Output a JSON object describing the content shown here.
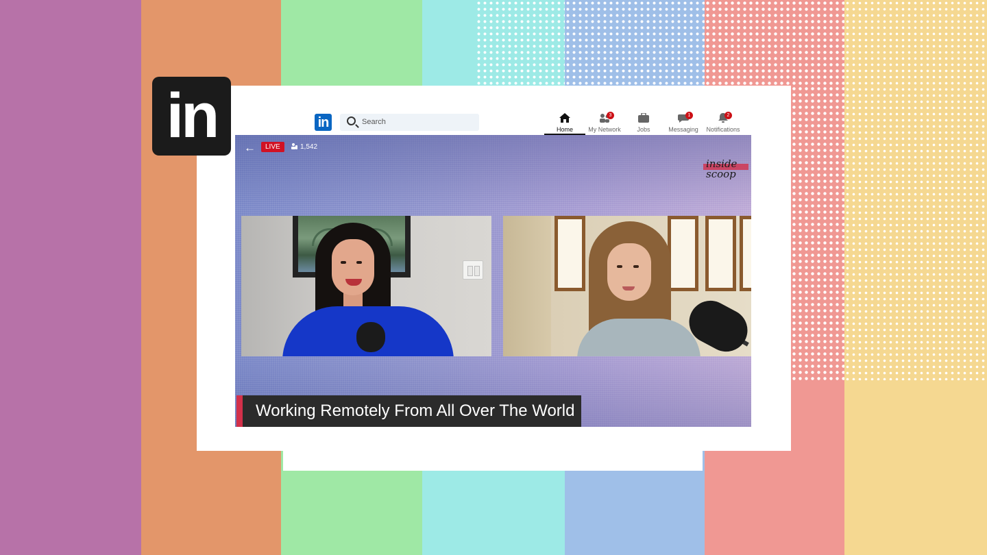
{
  "nav": {
    "logo_text": "in",
    "search_placeholder": "Search",
    "items": [
      {
        "label": "Home",
        "icon": "home-icon",
        "badge": ""
      },
      {
        "label": "My Network",
        "icon": "network-icon",
        "badge": "3"
      },
      {
        "label": "Jobs",
        "icon": "briefcase-icon",
        "badge": ""
      },
      {
        "label": "Messaging",
        "icon": "messaging-icon",
        "badge": "1"
      },
      {
        "label": "Notifications",
        "icon": "bell-icon",
        "badge": "2"
      }
    ]
  },
  "brand_logo_text": "in",
  "stream": {
    "live_label": "LIVE",
    "viewers": "1,542",
    "show_logo": {
      "line1": "inside",
      "line2": "scoop"
    },
    "caption": "Working Remotely From All Over The World"
  },
  "colors": {
    "linkedin_blue": "#0a66c2",
    "live_red": "#d11124",
    "accent_red": "#d3304a"
  }
}
